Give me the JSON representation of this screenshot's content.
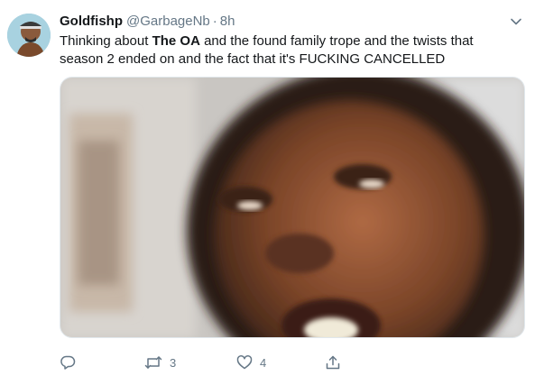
{
  "tweet": {
    "display_name": "Goldfishp",
    "handle": "@GarbageNb",
    "separator": "·",
    "time": "8h",
    "text_before": "Thinking about ",
    "text_bold": "The OA",
    "text_after": " and the found family trope and the twists that season 2 ended on and the fact that it's FUCKING CANCELLED",
    "replies": "",
    "retweets": "3",
    "likes": "4"
  },
  "icons": {
    "caret": "chevron-down-icon",
    "reply": "reply-icon",
    "retweet": "retweet-icon",
    "like": "heart-icon",
    "share": "share-icon"
  },
  "colors": {
    "text": "#14171a",
    "muted": "#657786",
    "border": "#e1e8ed"
  }
}
